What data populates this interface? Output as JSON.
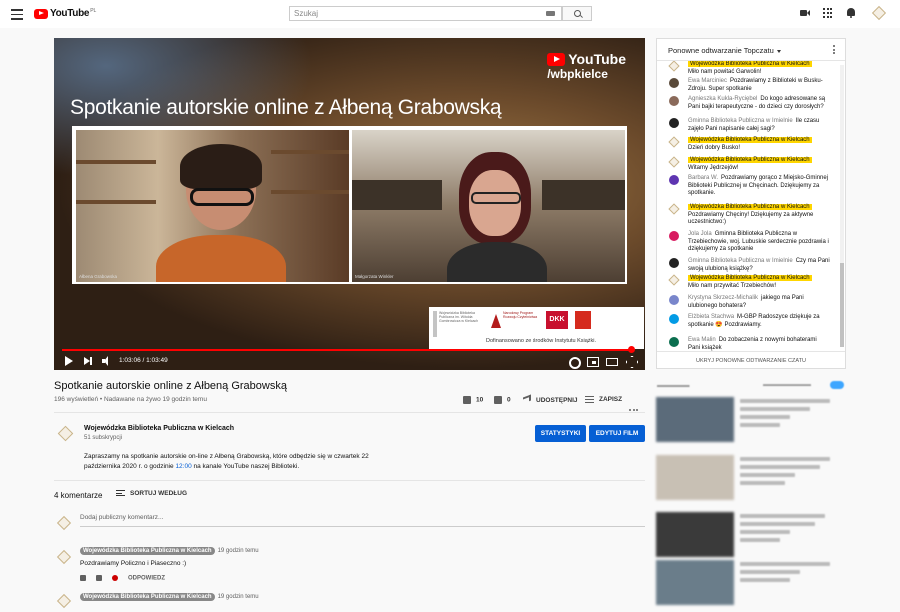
{
  "topbar": {
    "logo_text": "YouTube",
    "logo_region": "PL",
    "search_placeholder": "Szukaj"
  },
  "player": {
    "overlay_title": "Spotkanie autorskie online z Ałbeną Grabowską",
    "watermark_line1": "YouTube",
    "watermark_line2": "/wbpkielce",
    "caption_left": "Ałbena Grabowska",
    "caption_right": "Małgorzata Winkler",
    "sponsor_text": "Dofinansowano ze środków Instytutu Książki.",
    "sponsor_logo_1": "Wojewódzka Biblioteka Publiczna im. Witolda Gombrowicza w Kielcach",
    "sponsor_logo_2": "Narodowy Program Rozwoju Czytelnictwa",
    "sponsor_logo_3": "DKK",
    "time_display": "1:03:06 / 1:03:49",
    "progress_fraction": 0.989
  },
  "video": {
    "title": "Spotkanie autorskie online z Ałbeną Grabowską",
    "views": "196 wyświetleń • Nadawane na żywo 19 godzin temu",
    "likes": "10",
    "dislikes": "0",
    "share_label": "UDOSTĘPNIJ",
    "save_label": "ZAPISZ"
  },
  "channel": {
    "name": "Wojewódzka Biblioteka Publiczna w Kielcach",
    "subscribers": "51 subskrypcji",
    "stats_button": "STATYSTYKI",
    "edit_button": "EDYTUJ FILM",
    "description_part1": "Zapraszamy na spotkanie autorskie on-line z Ałbeną Grabowską, które odbędzie się w czwartek 22 października 2020 r. o godzinie ",
    "description_link": "12:00",
    "description_part2": " na kanale YouTube naszej Biblioteki."
  },
  "comments": {
    "count_label": "4 komentarze",
    "sort_label": "SORTUJ WEDŁUG",
    "add_placeholder": "Dodaj publiczny komentarz...",
    "items": [
      {
        "author": "Wojewódzka Biblioteka Publiczna w Kielcach",
        "time": "19 godzin temu",
        "text": "Pozdrawiamy Policzno i Piaseczno :)",
        "reply_label": "ODPOWIEDZ"
      },
      {
        "author": "Wojewódzka Biblioteka Publiczna w Kielcach",
        "time": "19 godzin temu"
      }
    ]
  },
  "chat": {
    "title": "Ponowne odtwarzanie Topczatu",
    "footer": "UKRYJ PONOWNE ODTWARZANIE CZATU",
    "messages": [
      {
        "author": "Wojewódzka Biblioteka Publiczna w Kielcach",
        "text": "Miło nam powitać Garwolin!",
        "owner": true,
        "avatar_color": "#f5efe4"
      },
      {
        "author": "Ewa Marciniec",
        "text": "Pozdrawiamy z Biblioteki w Busku-Zdroju. Super spotkanie",
        "owner": false,
        "avatar_color": "#5a4a3a"
      },
      {
        "author": "Agnieszka Kukla-Ryciębel",
        "text": "Do kogo adresowane są Pani bajki terapeutyczne - do dzieci czy dorosłych?",
        "owner": false,
        "avatar_color": "#8a6a5a"
      },
      {
        "author": "Gminna Biblioteka Publiczna w Imielnie",
        "text": "Ile czasu zajęło Pani napisanie całej sagi?",
        "owner": false,
        "avatar_color": "#222222"
      },
      {
        "author": "Wojewódzka Biblioteka Publiczna w Kielcach",
        "text": "Dzień dobry Busko!",
        "owner": true,
        "avatar_color": "#f5efe4"
      },
      {
        "author": "Wojewódzka Biblioteka Publiczna w Kielcach",
        "text": "Witamy Jędrzejów!",
        "owner": true,
        "avatar_color": "#f5efe4"
      },
      {
        "author": "Barbara W.",
        "text": "Pozdrawiamy gorąco z Miejsko-Gminnej Biblioteki Publicznej w Chęcinach. Dziękujemy za spotkanie.",
        "owner": false,
        "avatar_color": "#5e35b1"
      },
      {
        "author": "Wojewódzka Biblioteka Publiczna w Kielcach",
        "text": "Pozdrawiamy Chęciny! Dziękujemy za aktywne uczestnictwo:)",
        "owner": true,
        "avatar_color": "#f5efe4"
      },
      {
        "author": "Jola Jola",
        "text": "Gminna Biblioteka Publiczna w Trzebiechowie, woj. Lubuskie serdecznie pozdrawia i dziękujemy za spotkanie",
        "owner": false,
        "avatar_color": "#d81b60"
      },
      {
        "author": "Gminna Biblioteka Publiczna w Imielnie",
        "text": "Czy ma Pani swoją ulubioną książkę?",
        "owner": false,
        "avatar_color": "#222222"
      },
      {
        "author": "Wojewódzka Biblioteka Publiczna w Kielcach",
        "text": "Miło nam przywitać Trzebiechów!",
        "owner": true,
        "avatar_color": "#f5efe4"
      },
      {
        "author": "Krystyna Skrzecz-Michalik",
        "text": "jakiego ma Pani ulubionego bohatera?",
        "owner": false,
        "avatar_color": "#7986cb"
      },
      {
        "author": "Elżbieta Stachwa",
        "text": "M-GBP Radoszyce dziękuje za spotkanie 😍 Pozdrawiamy.",
        "owner": false,
        "avatar_color": "#039be5"
      },
      {
        "author": "Ewa Malin",
        "text": "Do zobaczenia z nowymi bohaterami Pani książek",
        "owner": false,
        "avatar_color": "#0b6e4f"
      }
    ]
  },
  "colors": {
    "accent": "#065fd4",
    "progress": "#ff0000",
    "owner_highlight": "#ffd600"
  }
}
